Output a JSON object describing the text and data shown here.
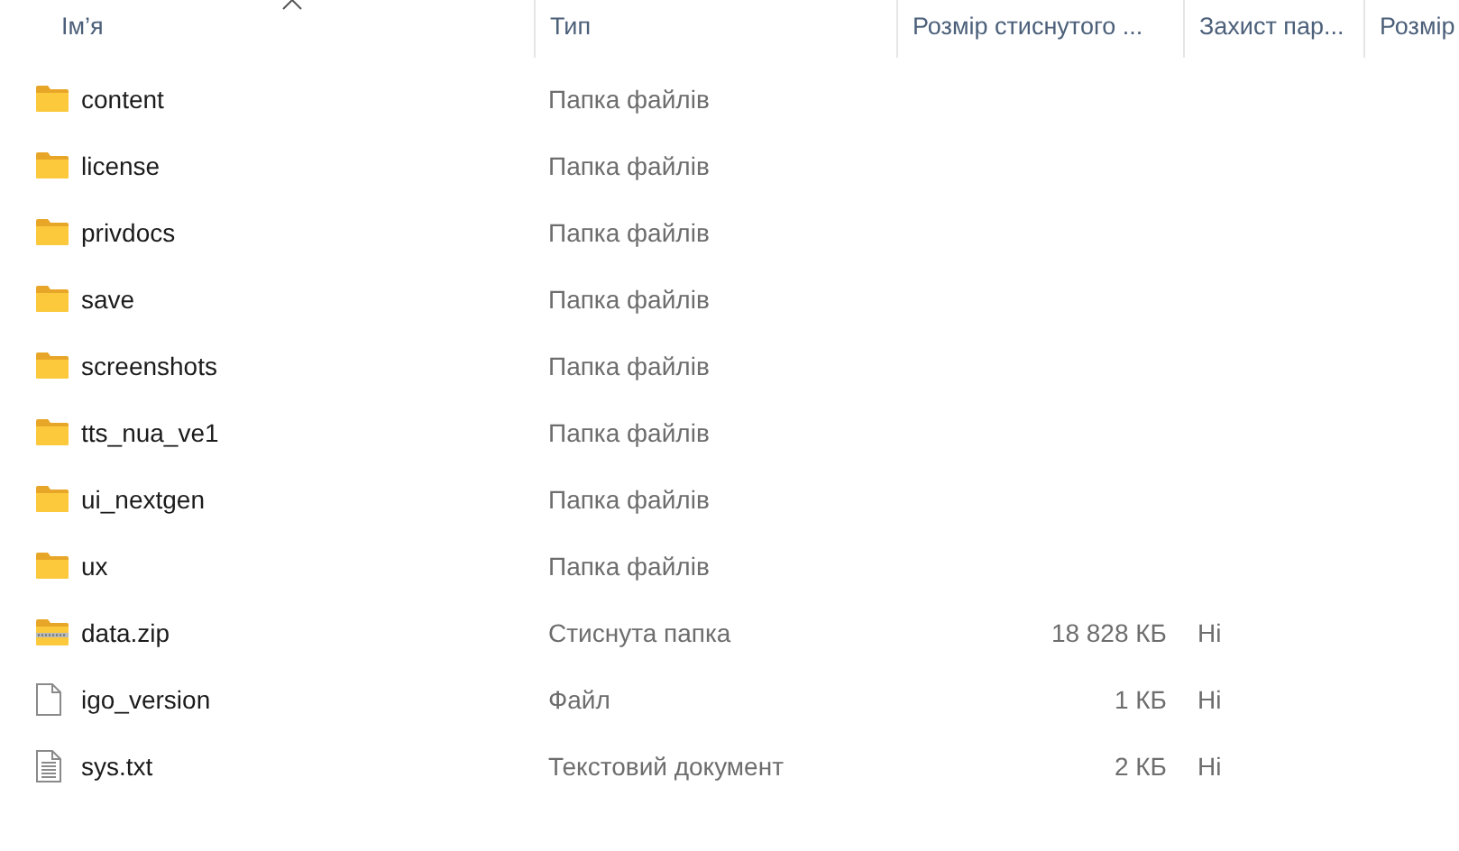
{
  "table": {
    "columns": [
      "Ім’я",
      "Тип",
      "Розмір стиснутого ...",
      "Захист пар...",
      "Розмір"
    ],
    "sort_indicator": true,
    "rows": [
      {
        "kind": "folder",
        "name": "content",
        "type": "Папка файлів"
      },
      {
        "kind": "folder",
        "name": "license",
        "type": "Папка файлів"
      },
      {
        "kind": "folder",
        "name": "privdocs",
        "type": "Папка файлів"
      },
      {
        "kind": "folder",
        "name": "save",
        "type": "Папка файлів"
      },
      {
        "kind": "folder",
        "name": "screenshots",
        "type": "Папка файлів"
      },
      {
        "kind": "folder",
        "name": "tts_nua_ve1",
        "type": "Папка файлів"
      },
      {
        "kind": "folder",
        "name": "ui_nextgen",
        "type": "Папка файлів"
      },
      {
        "kind": "folder",
        "name": "ux",
        "type": "Папка файлів"
      },
      {
        "kind": "zip",
        "name": "data.zip",
        "type": "Стиснута папка",
        "compressed_size": "18 828 КБ",
        "password": "Ні"
      },
      {
        "kind": "file",
        "name": "igo_version",
        "type": "Файл",
        "compressed_size": "1 КБ",
        "password": "Ні"
      },
      {
        "kind": "text",
        "name": "sys.txt",
        "type": "Текстовий документ",
        "compressed_size": "2 КБ",
        "password": "Ні"
      }
    ]
  }
}
